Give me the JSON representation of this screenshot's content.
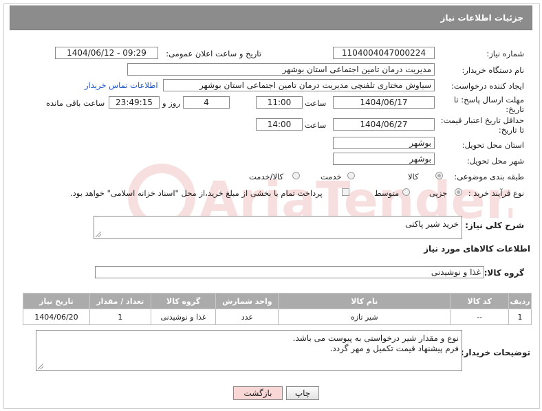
{
  "header": {
    "title": "جزئیات اطلاعات نیاز"
  },
  "fields": {
    "need_number": {
      "label": "شماره نیاز:",
      "value": "1104004047000224"
    },
    "announce_datetime": {
      "label": "تاریخ و ساعت اعلان عمومی:",
      "value": "1404/06/12 - 09:29"
    },
    "buyer_org": {
      "label": "نام دستگاه خریدار:",
      "value": "مدیریت درمان تامین اجتماعی استان بوشهر"
    },
    "requester": {
      "label": "ایجاد کننده درخواست:",
      "value": "سیاوش مختاری تلفنچی مدیریت درمان تامین اجتماعی استان بوشهر",
      "contact_link": "اطلاعات تماس خریدار"
    },
    "reply_deadline": {
      "label_line1": "مهلت ارسال پاسخ: تا",
      "label_line2": "تاریخ:",
      "date": "1404/06/17",
      "time_label": "ساعت",
      "time": "11:00",
      "days": "4",
      "days_label": "روز و",
      "remaining": "23:49:15",
      "remaining_label": "ساعت باقی مانده"
    },
    "price_validity": {
      "label_line1": "حداقل تاریخ اعتبار قیمت:",
      "label_line2": "تا تاریخ:",
      "date": "1404/06/27",
      "time_label": "ساعت",
      "time": "14:00"
    },
    "delivery_province": {
      "label": "استان محل تحویل:",
      "value": "بوشهر"
    },
    "delivery_city": {
      "label": "شهر محل تحویل:",
      "value": "بوشهر"
    },
    "category": {
      "label": "طبقه بندی موضوعی:",
      "options": [
        "کالا",
        "خدمت",
        "کالا/خدمت"
      ],
      "selected": "کالا"
    },
    "purchase_process": {
      "label": "نوع فرآیند خرید :",
      "options": [
        "جزیی",
        "متوسط"
      ],
      "selected": "جزیی",
      "payment_note": "پرداخت تمام یا بخشی از مبلغ خرید،از محل \"اسناد خزانه اسلامی\" خواهد بود."
    }
  },
  "summary": {
    "label": "شرح کلی نیاز:",
    "value": "خرید شیر پاکتی"
  },
  "goods_section": {
    "title": "اطلاعات کالاهای مورد نیاز",
    "group_label": "گروه کالا:",
    "group_value": "غذا و نوشیدنی"
  },
  "table": {
    "columns": [
      "ردیف",
      "کد کالا",
      "نام کالا",
      "واحد شمارش",
      "گروه کالا",
      "تعداد / مقدار",
      "تاریخ نیاز"
    ],
    "rows": [
      [
        "1",
        "--",
        "شیر تازه",
        "عدد",
        "غذا و نوشیدنی",
        "1",
        "1404/06/20"
      ]
    ]
  },
  "buyer_notes": {
    "label": "توضیحات خریدار:",
    "line1": "نوع و مقدار شیر درخواستی به پیوست می باشد.",
    "line2": "فرم پیشنهاد قیمت تکمیل و مهر گردد."
  },
  "buttons": {
    "print": "چاپ",
    "back": "بازگشت"
  },
  "colors": {
    "header_bg": "#8c8c8c",
    "table_header_bg": "#ababab",
    "link": "#1a55c8",
    "back_button_bg": "#f9d7d7"
  },
  "watermark": {
    "text": "AriaTender.net"
  }
}
